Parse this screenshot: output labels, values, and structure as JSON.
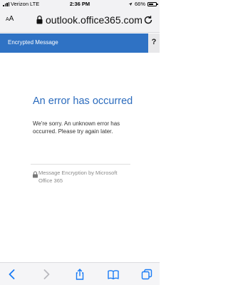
{
  "status_bar": {
    "carrier": "Verizon",
    "network": "LTE",
    "time": "2:36 PM",
    "battery_percent": "66%",
    "battery_level": 0.66
  },
  "browser": {
    "text_size_label": "AA",
    "url": "outlook.office365.com"
  },
  "header": {
    "title": "Encrypted Message",
    "help_label": "?"
  },
  "error": {
    "title": "An error has occurred",
    "message": "We're sorry. An unknown error has occurred. Please try again later."
  },
  "footer": {
    "text": "Message Encryption by Microsoft Office 365"
  },
  "colors": {
    "header_blue": "#2f72c4",
    "title_blue": "#2b6bbd",
    "ios_blue": "#1a7cf5"
  },
  "toolbar": {
    "icons": [
      "back-icon",
      "forward-icon",
      "share-icon",
      "bookmarks-icon",
      "tabs-icon"
    ]
  }
}
